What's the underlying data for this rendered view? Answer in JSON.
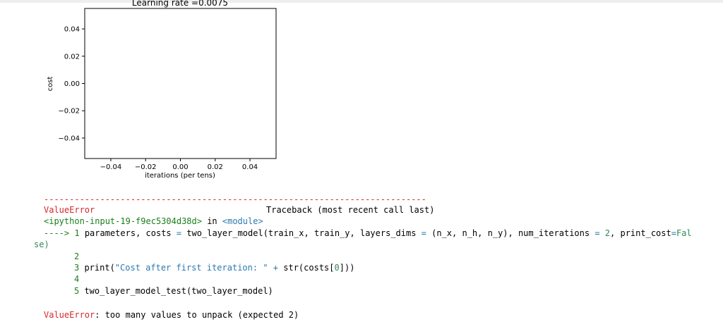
{
  "chart_data": {
    "type": "line",
    "title": "Learning rate =0.0075",
    "xlabel": "iterations (per tens)",
    "ylabel": "cost",
    "xlim": [
      -0.055,
      0.055
    ],
    "ylim": [
      -0.055,
      0.055
    ],
    "x_ticks": [
      "−0.04",
      "−0.02",
      "0.00",
      "0.02",
      "0.04"
    ],
    "y_ticks": [
      "0.04",
      "0.02",
      "0.00",
      "−0.02",
      "−0.04"
    ],
    "series": [],
    "grid": false
  },
  "traceback": {
    "separator": "---------------------------------------------------------------------------",
    "error_name": "ValueError",
    "header_right": "Traceback (most recent call last)",
    "input_ref": "<ipython-input-19-f9ec5304d38d>",
    "in_word": " in ",
    "module": "<module>",
    "arrow": "----> ",
    "line1_num": "1",
    "line1_a": " parameters, costs ",
    "line1_eq": "=",
    "line1_b": " two_layer_model(train_x, train_y, layers_dims ",
    "line1_eq2": "=",
    "line1_c": " (n_x, n_h, n_y), num_iterations ",
    "line1_eq3": "=",
    "line1_num2": " 2",
    "line1_d": ", print_cost",
    "line1_eq4": "=",
    "line1_fal": "Fal",
    "line1_cont": "se)",
    "line2_num": "2",
    "line3_num": "3",
    "line3_a": " print(",
    "line3_str": "\"Cost after first iteration: \"",
    "line3_b": " ",
    "line3_plus": "+",
    "line3_c": " str(costs[",
    "line3_idx": "0",
    "line3_d": "]))",
    "line4_num": "4",
    "line5_num": "5",
    "line5_a": " two_layer_model_test(two_layer_model)",
    "final_error": "ValueError",
    "final_msg": ": too many values to unpack (expected 2)"
  }
}
